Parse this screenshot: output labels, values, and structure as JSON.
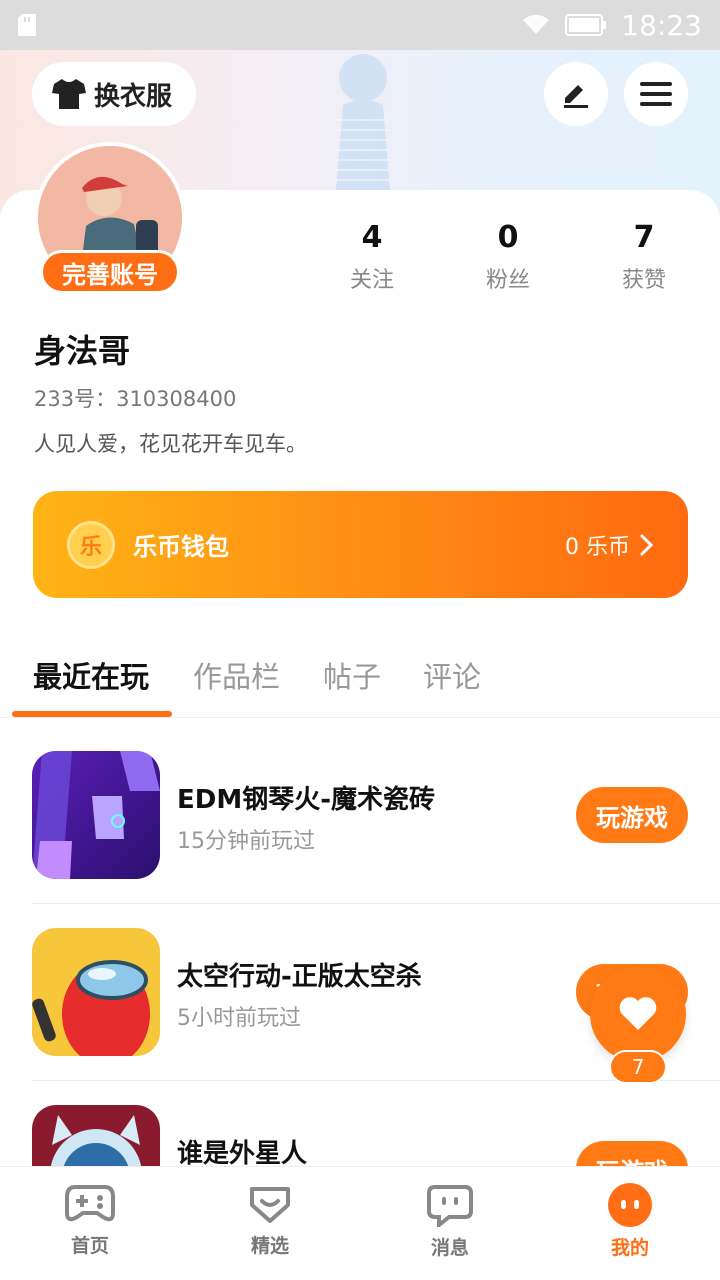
{
  "status_bar": {
    "time": "18:23"
  },
  "header": {
    "outfit_label": "换衣服"
  },
  "profile": {
    "complete_label": "完善账号",
    "username": "身法哥",
    "uid": "233号：310308400",
    "bio": "人见人爱，花见花开车见车。",
    "stats": [
      {
        "value": "4",
        "label": "关注"
      },
      {
        "value": "0",
        "label": "粉丝"
      },
      {
        "value": "7",
        "label": "获赞"
      }
    ]
  },
  "wallet": {
    "coin_glyph": "乐",
    "title": "乐币钱包",
    "balance": "0 乐币"
  },
  "tabs": [
    "最近在玩",
    "作品栏",
    "帖子",
    "评论"
  ],
  "games": [
    {
      "name": "EDM钢琴火-魔术瓷砖",
      "time": "15分钟前玩过",
      "button": "玩游戏"
    },
    {
      "name": "太空行动-正版太空杀",
      "time": "5小时前玩过",
      "button": "玩游戏"
    },
    {
      "name": "谁是外星人",
      "time": "",
      "button": "玩游戏"
    }
  ],
  "like_float": {
    "count": "7"
  },
  "bottom_nav": [
    {
      "label": "首页",
      "icon": "gamepad-icon"
    },
    {
      "label": "精选",
      "icon": "heart-chat-icon"
    },
    {
      "label": "消息",
      "icon": "message-icon"
    },
    {
      "label": "我的",
      "icon": "profile-face-icon"
    }
  ],
  "colors": {
    "accent": "#ff6e14"
  }
}
